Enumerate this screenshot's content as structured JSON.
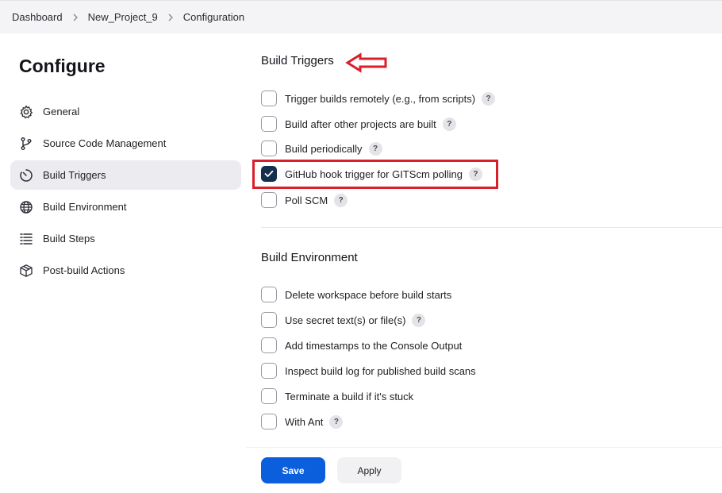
{
  "breadcrumb": {
    "items": [
      {
        "label": "Dashboard"
      },
      {
        "label": "New_Project_9"
      },
      {
        "label": "Configuration"
      }
    ]
  },
  "page_title": "Configure",
  "sidebar": {
    "items": [
      {
        "label": "General",
        "icon": "gear-icon",
        "active": false
      },
      {
        "label": "Source Code Management",
        "icon": "branch-icon",
        "active": false
      },
      {
        "label": "Build Triggers",
        "icon": "timer-icon",
        "active": true
      },
      {
        "label": "Build Environment",
        "icon": "globe-icon",
        "active": false
      },
      {
        "label": "Build Steps",
        "icon": "list-icon",
        "active": false
      },
      {
        "label": "Post-build Actions",
        "icon": "package-icon",
        "active": false
      }
    ]
  },
  "build_triggers": {
    "title": "Build Triggers",
    "options": [
      {
        "label": "Trigger builds remotely (e.g., from scripts)",
        "checked": false,
        "help": "?"
      },
      {
        "label": "Build after other projects are built",
        "checked": false,
        "help": "?"
      },
      {
        "label": "Build periodically",
        "checked": false,
        "help": "?"
      },
      {
        "label": "GitHub hook trigger for GITScm polling",
        "checked": true,
        "help": "?"
      },
      {
        "label": "Poll SCM",
        "checked": false,
        "help": "?"
      }
    ]
  },
  "build_environment": {
    "title": "Build Environment",
    "options": [
      {
        "label": "Delete workspace before build starts",
        "checked": false
      },
      {
        "label": "Use secret text(s) or file(s)",
        "checked": false,
        "help": "?"
      },
      {
        "label": "Add timestamps to the Console Output",
        "checked": false
      },
      {
        "label": "Inspect build log for published build scans",
        "checked": false
      },
      {
        "label": "Terminate a build if it's stuck",
        "checked": false
      },
      {
        "label": "With Ant",
        "checked": false,
        "help": "?"
      }
    ]
  },
  "actions": {
    "save_label": "Save",
    "apply_label": "Apply"
  },
  "colors": {
    "accent": "#0b5fdc",
    "checked": "#14304f",
    "annotation": "#d9202a"
  }
}
